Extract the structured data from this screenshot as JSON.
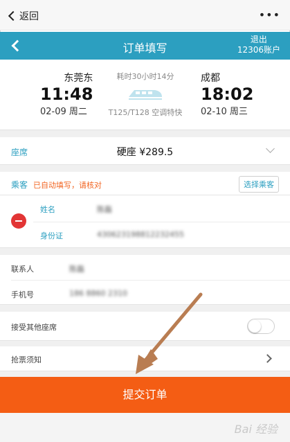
{
  "topbar": {
    "back_label": "返回",
    "more_label": "•••"
  },
  "header": {
    "title": "订单填写",
    "right_line1": "退出",
    "right_line2": "12306账户"
  },
  "train": {
    "from_station": "东莞东",
    "from_time": "11:48",
    "from_date": "02-09 周二",
    "to_station": "成都",
    "to_time": "18:02",
    "to_date": "02-10 周三",
    "duration": "耗时30小时14分",
    "train_no": "T125/T128 空调特快"
  },
  "seat": {
    "label": "座席",
    "value": "硬座 ¥289.5"
  },
  "passenger": {
    "label": "乘客",
    "auto_note": "已自动填写，请核对",
    "choose_label": "选择乘客",
    "name_label": "姓名",
    "name_value": "陈磊",
    "id_label": "身份证",
    "id_value": "430623198812232455"
  },
  "contact": {
    "contact_label": "联系人",
    "contact_value": "陈磊",
    "phone_label": "手机号",
    "phone_value": "186 8860 2310"
  },
  "accept_other": {
    "label": "接受其他座席"
  },
  "ticket_notice": {
    "label": "抢票须知"
  },
  "submit": {
    "label": "提交订单"
  },
  "watermark": {
    "text": "Bai 经验"
  },
  "colors": {
    "accent": "#2c9fc0",
    "submit": "#f45d14",
    "warning": "#f26522",
    "arrow": "#b97d52"
  }
}
